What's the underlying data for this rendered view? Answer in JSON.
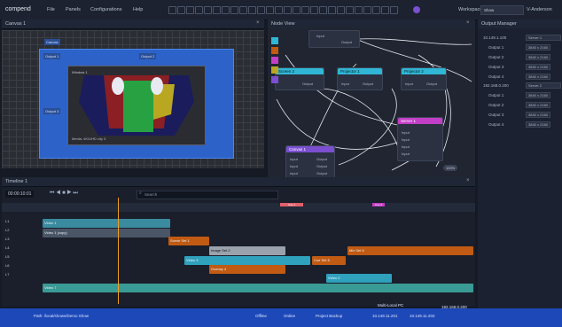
{
  "app": {
    "name": "compend"
  },
  "menu": [
    "File",
    "Panels",
    "Configurations",
    "Help"
  ],
  "topbar": {
    "workspace_label": "Workspace",
    "workspace_value": "Show",
    "user": "V-Anderson"
  },
  "canvas": {
    "title": "Canvas 1",
    "top_tag": "Canvas",
    "output_tags": [
      "Output 1",
      "Output 2",
      "Output 3"
    ],
    "screen_caption": "Window 1",
    "screen_footer": "Media: 4K/UHD clip 3"
  },
  "node_view": {
    "title": "Node View",
    "nodes": [
      {
        "label": "Input",
        "sub": "Output"
      },
      {
        "label": "Screen 2",
        "ports_in": [
          "Input"
        ],
        "ports_out": [
          "Output"
        ]
      },
      {
        "label": "Projector 1",
        "ports_in": [
          "Input"
        ],
        "ports_out": [
          "Output"
        ]
      },
      {
        "label": "Projector 2",
        "ports_in": [
          "Input"
        ],
        "ports_out": [
          "Output"
        ]
      },
      {
        "label": "Server 1",
        "ports_in": [
          "Input",
          "Input",
          "Input",
          "Input"
        ]
      },
      {
        "label": "Canvas 1",
        "ports_in": [
          "Input",
          "Input",
          "Input"
        ],
        "ports_out": [
          "Output",
          "Output",
          "Output"
        ]
      }
    ],
    "zoom": "100%"
  },
  "output_manager": {
    "title": "Output Manager",
    "groups": [
      {
        "ip": "10.149.1.100",
        "server": "Server 1",
        "outputs": [
          [
            "Output 1",
            "3840 x 2160"
          ],
          [
            "Output 2",
            "3840 x 2160"
          ],
          [
            "Output 3",
            "3840 x 2160"
          ],
          [
            "Output 4",
            "3840 x 2160"
          ]
        ]
      },
      {
        "ip": "192.168.0.200",
        "server": "Server 2",
        "outputs": [
          [
            "Output 1",
            "3840 x 2160"
          ],
          [
            "Output 2",
            "3840 x 2160"
          ],
          [
            "Output 3",
            "3840 x 2160"
          ],
          [
            "Output 4",
            "3840 x 2160"
          ]
        ]
      }
    ]
  },
  "timeline": {
    "title": "Timeline 1",
    "timecode": "00:00:10:01",
    "search_placeholder": "Search",
    "rows": [
      "L1",
      "L2",
      "L3",
      "L4",
      "L5",
      "L6",
      "L7"
    ],
    "clips": [
      "Video 1",
      "Video 1 (copy)",
      "Scene Set 1",
      "Image Set 2",
      "Video 3",
      "Overlay 4",
      "Cue Set 5",
      "Mix Set 6",
      "Video 2",
      "Video 7"
    ],
    "markers": [
      "Cue 1",
      "Cue 2"
    ]
  },
  "status": {
    "path": "Path: /local/shows/Demo Show",
    "sync": "Offline",
    "mode": "Online",
    "proj": "Project Backup",
    "local_pc": "Multi-Local PC",
    "ip1": "10.149.11.201",
    "ip2": "10.149.11.202",
    "ip3": "192.168.0.200"
  },
  "colors": {
    "accent": "#2d62c8",
    "cyan": "#2fb7d5",
    "orange": "#c15a12",
    "magenta": "#c33ec6",
    "purple": "#7b4fd0",
    "teal": "#3aa7a0"
  }
}
